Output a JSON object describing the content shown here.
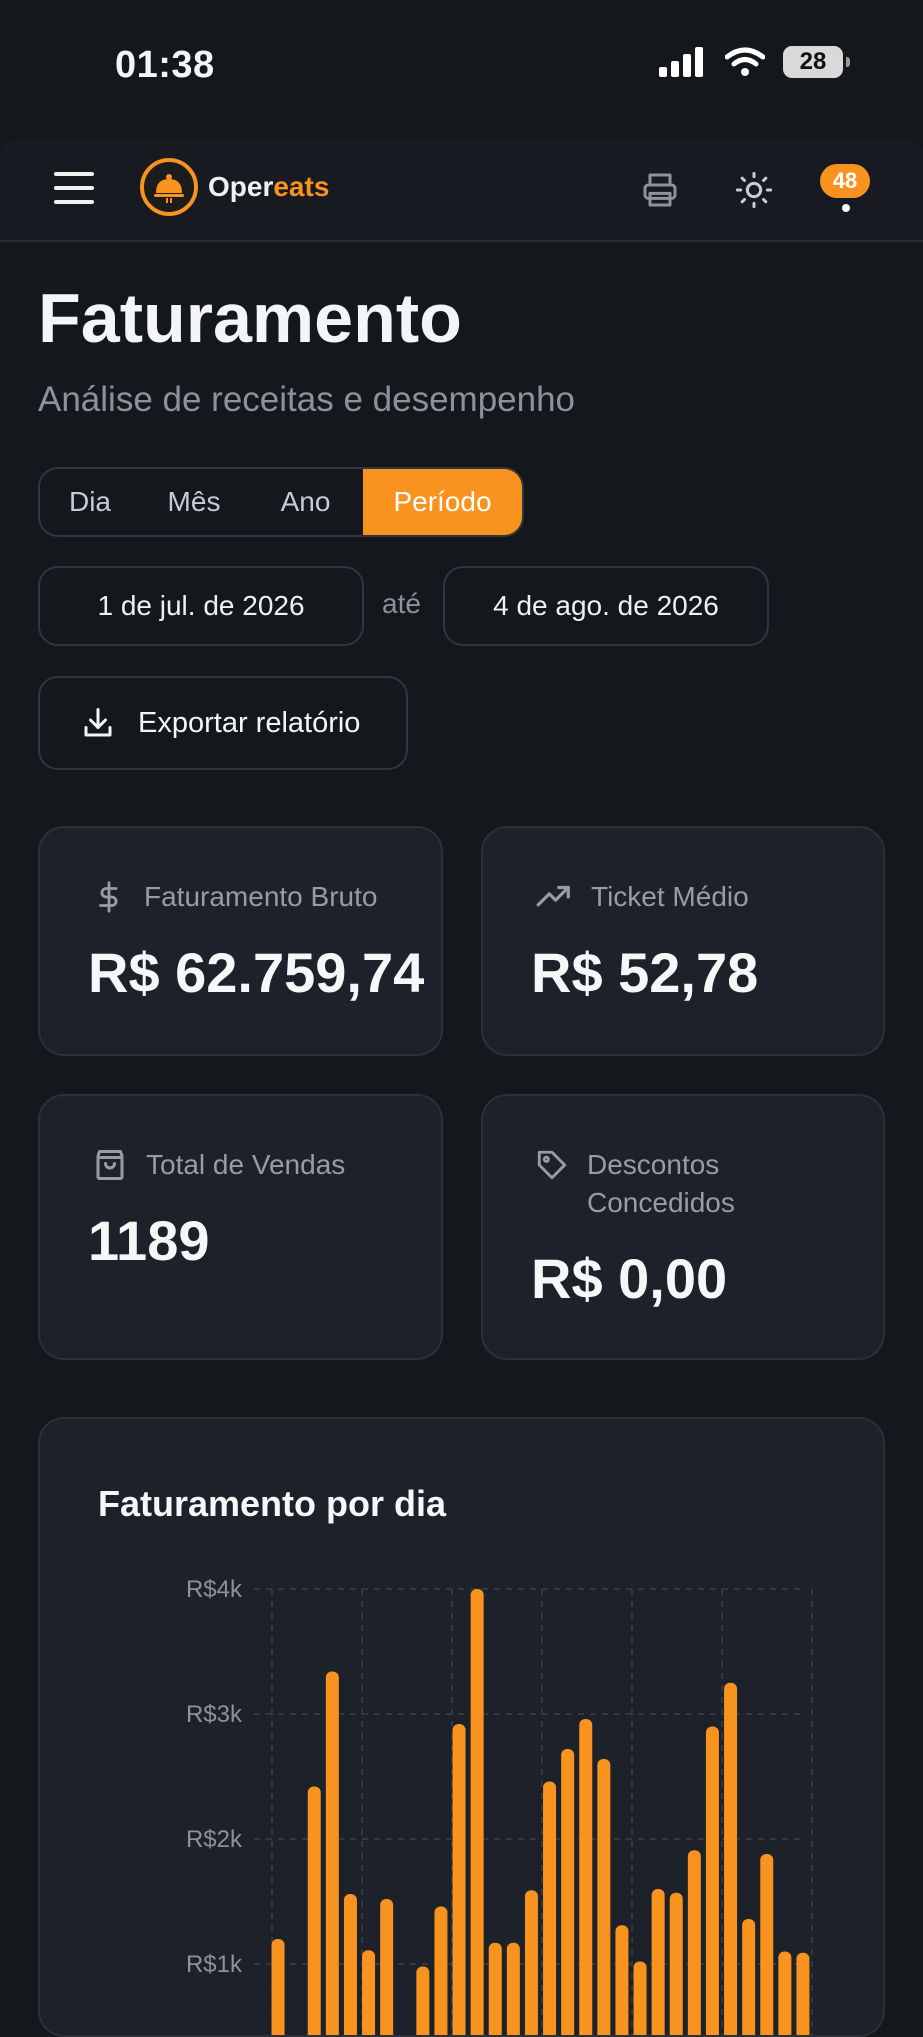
{
  "status_bar": {
    "time": "01:38",
    "battery": "28"
  },
  "app": {
    "brand_part1": "Oper",
    "brand_part2": "eats",
    "notifications_count": "48",
    "accent_color": "#f7931e"
  },
  "page": {
    "title": "Faturamento",
    "subtitle": "Análise de receitas e desempenho"
  },
  "period_tabs": {
    "items": [
      "Dia",
      "Mês",
      "Ano",
      "Período"
    ],
    "active": "Período"
  },
  "date_range": {
    "start": "1 de jul. de 2026",
    "separator": "até",
    "end": "4 de ago. de 2026"
  },
  "export_button": {
    "label": "Exportar relatório",
    "icon": "download-icon"
  },
  "metrics": [
    {
      "label": "Faturamento Bruto",
      "value": "R$ 62.759,74",
      "icon": "dollar-icon"
    },
    {
      "label": "Ticket Médio",
      "value": "R$ 52,78",
      "icon": "trending-up-icon"
    },
    {
      "label": "Total de Vendas",
      "value": "1189",
      "icon": "shopping-bag-icon"
    },
    {
      "label": "Descontos Concedidos",
      "label_line1": "Descontos",
      "label_line2": "Concedidos",
      "value": "R$ 0,00",
      "icon": "tag-icon"
    }
  ],
  "chart_data": {
    "type": "bar",
    "title": "Faturamento por dia",
    "ytick_labels": [
      "R$4k",
      "R$3k",
      "R$2k",
      "R$1k"
    ],
    "ylim": [
      0,
      4000
    ],
    "grid": true,
    "color": "#f7931e",
    "values": [
      1200,
      0,
      2420,
      3340,
      1560,
      1110,
      1520,
      0,
      980,
      1460,
      2920,
      4000,
      1170,
      1170,
      1590,
      2460,
      2720,
      2960,
      2640,
      1310,
      1020,
      1600,
      1570,
      1910,
      2900,
      3250,
      1360,
      1880,
      1100,
      1090
    ]
  }
}
